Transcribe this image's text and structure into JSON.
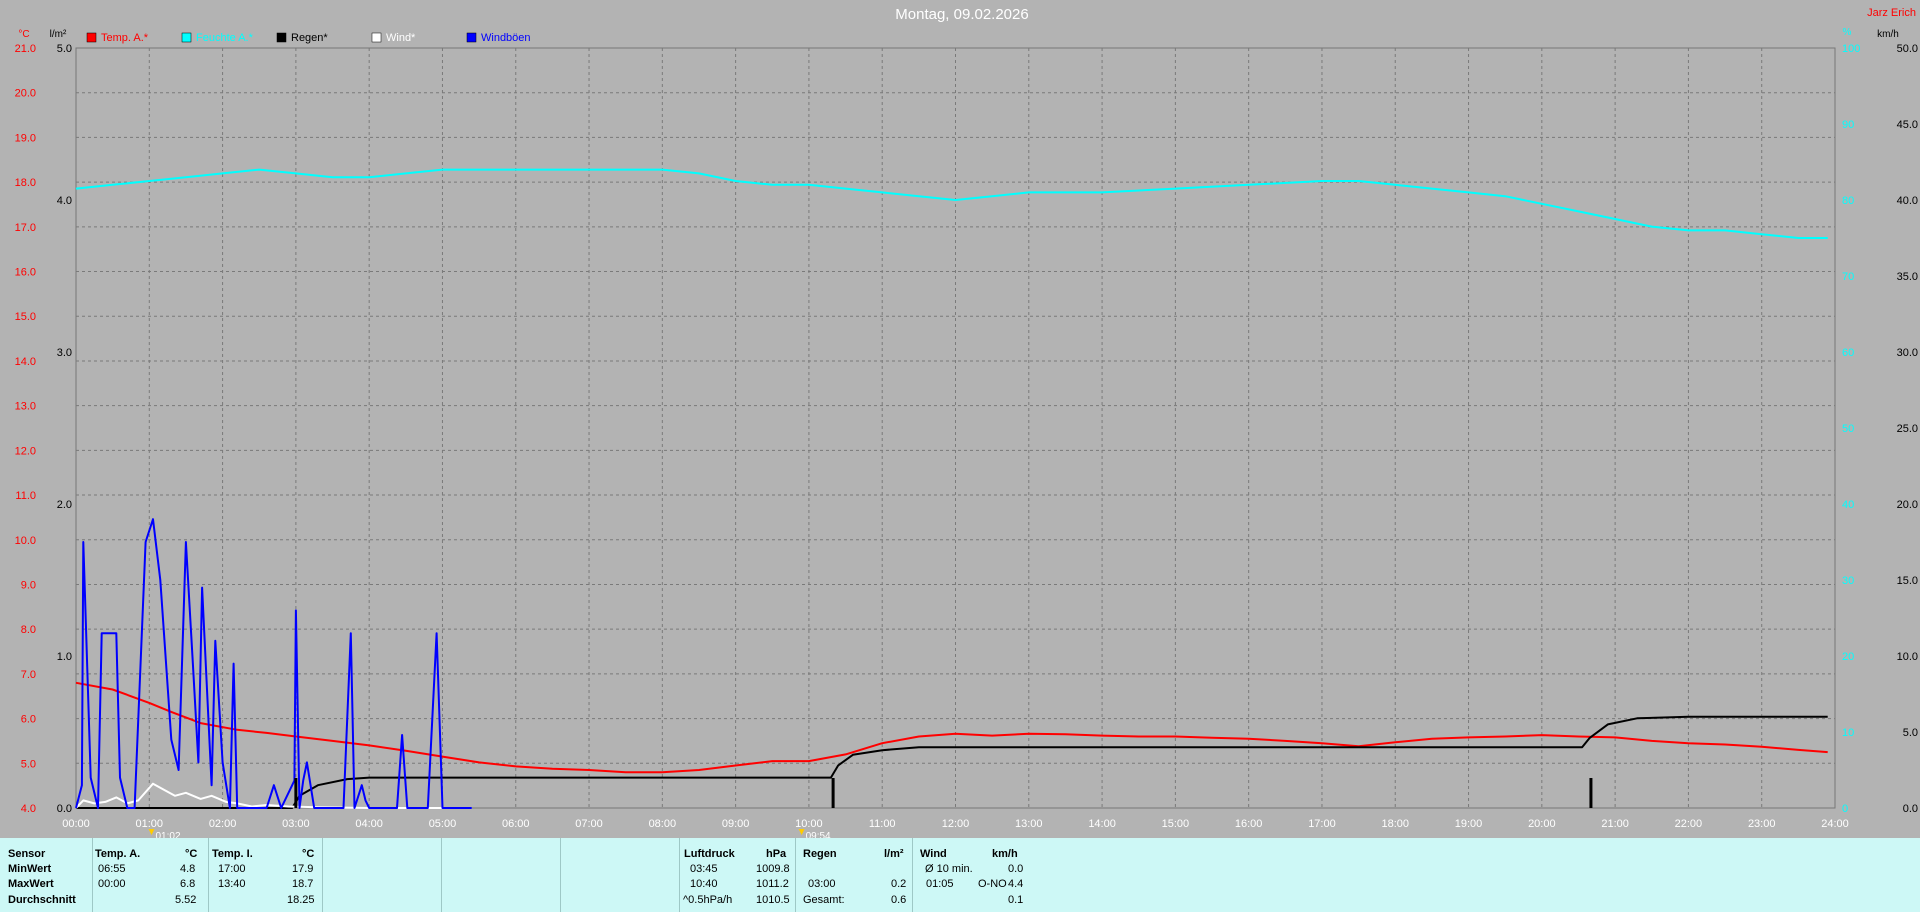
{
  "title": "Montag, 09.02.2026",
  "station": "Jarz Erich",
  "colors": {
    "background": "#b3b3b3",
    "temp": "#ff0000",
    "humidity": "#00ffff",
    "rain": "#000000",
    "wind": "#ffffff",
    "gusts": "#0000ff"
  },
  "axis_units": {
    "left_temp": "°C",
    "left_rain": "l/m²",
    "right_hum": "%",
    "right_wind": "km/h"
  },
  "legend": [
    {
      "key": "temp",
      "label": "Temp. A.*",
      "color": "#ff0000"
    },
    {
      "key": "humidity",
      "label": "Feuchte A.*",
      "color": "#00ffff"
    },
    {
      "key": "rain",
      "label": "Regen*",
      "color": "#000000"
    },
    {
      "key": "wind",
      "label": "Wind*",
      "color": "#ffffff"
    },
    {
      "key": "gusts",
      "label": "Windböen",
      "color": "#0000ff"
    }
  ],
  "markers": [
    {
      "x": 1.03,
      "label": "01:02"
    },
    {
      "x": 9.9,
      "label": "09:54"
    }
  ],
  "chart_data": {
    "type": "line",
    "x_unit": "hour of day",
    "xlim": [
      0,
      24
    ],
    "x_ticks": [
      "00:00",
      "01:00",
      "02:00",
      "03:00",
      "04:00",
      "05:00",
      "06:00",
      "07:00",
      "08:00",
      "09:00",
      "10:00",
      "11:00",
      "12:00",
      "13:00",
      "14:00",
      "15:00",
      "16:00",
      "17:00",
      "18:00",
      "19:00",
      "20:00",
      "21:00",
      "22:00",
      "23:00",
      "24:00"
    ],
    "axes": {
      "temp": {
        "range": [
          4,
          21
        ],
        "ticks": [
          "4.0",
          "5.0",
          "6.0",
          "7.0",
          "8.0",
          "9.0",
          "10.0",
          "11.0",
          "12.0",
          "13.0",
          "14.0",
          "15.0",
          "16.0",
          "17.0",
          "18.0",
          "19.0",
          "20.0",
          "21.0"
        ]
      },
      "rain": {
        "range": [
          0,
          5
        ],
        "ticks": [
          "0.0",
          "1.0",
          "2.0",
          "3.0",
          "4.0",
          "5.0"
        ]
      },
      "humidity": {
        "range": [
          0,
          100
        ],
        "ticks": [
          "0",
          "10",
          "20",
          "30",
          "40",
          "50",
          "60",
          "70",
          "80",
          "90",
          "100"
        ]
      },
      "wind": {
        "range": [
          0,
          50
        ],
        "ticks": [
          "0.0",
          "5.0",
          "10.0",
          "15.0",
          "20.0",
          "25.0",
          "30.0",
          "35.0",
          "40.0",
          "45.0",
          "50.0"
        ]
      }
    },
    "series": [
      {
        "name": "Temp. A.*",
        "axis": "temp",
        "points": [
          [
            0,
            6.8
          ],
          [
            0.5,
            6.65
          ],
          [
            1,
            6.35
          ],
          [
            1.3,
            6.15
          ],
          [
            1.7,
            5.9
          ],
          [
            2.2,
            5.75
          ],
          [
            2.6,
            5.68
          ],
          [
            3,
            5.6
          ],
          [
            3.5,
            5.5
          ],
          [
            4,
            5.4
          ],
          [
            4.5,
            5.28
          ],
          [
            5,
            5.15
          ],
          [
            5.5,
            5.02
          ],
          [
            6,
            4.93
          ],
          [
            6.5,
            4.88
          ],
          [
            7,
            4.85
          ],
          [
            7.5,
            4.8
          ],
          [
            8,
            4.8
          ],
          [
            8.5,
            4.85
          ],
          [
            9,
            4.95
          ],
          [
            9.5,
            5.05
          ],
          [
            10,
            5.05
          ],
          [
            10.5,
            5.2
          ],
          [
            11,
            5.45
          ],
          [
            11.5,
            5.6
          ],
          [
            12,
            5.66
          ],
          [
            12.5,
            5.62
          ],
          [
            13,
            5.66
          ],
          [
            13.5,
            5.65
          ],
          [
            14,
            5.62
          ],
          [
            14.5,
            5.6
          ],
          [
            15,
            5.6
          ],
          [
            15.5,
            5.57
          ],
          [
            16,
            5.55
          ],
          [
            16.5,
            5.5
          ],
          [
            17,
            5.45
          ],
          [
            17.5,
            5.38
          ],
          [
            18,
            5.47
          ],
          [
            18.5,
            5.55
          ],
          [
            19,
            5.58
          ],
          [
            19.5,
            5.6
          ],
          [
            20,
            5.63
          ],
          [
            20.5,
            5.6
          ],
          [
            21,
            5.58
          ],
          [
            21.5,
            5.5
          ],
          [
            22,
            5.45
          ],
          [
            22.5,
            5.42
          ],
          [
            23,
            5.37
          ],
          [
            23.5,
            5.3
          ],
          [
            23.9,
            5.25
          ]
        ]
      },
      {
        "name": "Feuchte A.*",
        "axis": "humidity",
        "points": [
          [
            0,
            81.5
          ],
          [
            0.5,
            82
          ],
          [
            1,
            82.5
          ],
          [
            1.5,
            83
          ],
          [
            2,
            83.5
          ],
          [
            2.5,
            84
          ],
          [
            3,
            83.5
          ],
          [
            3.5,
            83
          ],
          [
            4,
            83
          ],
          [
            4.5,
            83.5
          ],
          [
            5,
            84
          ],
          [
            6,
            84
          ],
          [
            7,
            84
          ],
          [
            8,
            84
          ],
          [
            8.5,
            83.5
          ],
          [
            9,
            82.5
          ],
          [
            9.5,
            82
          ],
          [
            10,
            82
          ],
          [
            10.5,
            81.5
          ],
          [
            11,
            81
          ],
          [
            11.5,
            80.5
          ],
          [
            12,
            80
          ],
          [
            12.5,
            80.5
          ],
          [
            13,
            81
          ],
          [
            14,
            81
          ],
          [
            15,
            81.5
          ],
          [
            16,
            82
          ],
          [
            17,
            82.5
          ],
          [
            17.5,
            82.5
          ],
          [
            18,
            82
          ],
          [
            18.5,
            81.5
          ],
          [
            19,
            81
          ],
          [
            19.5,
            80.5
          ],
          [
            20,
            79.5
          ],
          [
            20.5,
            78.5
          ],
          [
            21,
            77.5
          ],
          [
            21.5,
            76.5
          ],
          [
            22,
            76
          ],
          [
            22.5,
            76
          ],
          [
            23,
            75.5
          ],
          [
            23.5,
            75
          ],
          [
            23.9,
            75
          ]
        ]
      },
      {
        "name": "Regen*",
        "axis": "rain",
        "points": [
          [
            0,
            0
          ],
          [
            2.95,
            0
          ],
          [
            3.05,
            0.08
          ],
          [
            3.3,
            0.15
          ],
          [
            3.7,
            0.19
          ],
          [
            4,
            0.2
          ],
          [
            10.3,
            0.2
          ],
          [
            10.4,
            0.28
          ],
          [
            10.6,
            0.35
          ],
          [
            11,
            0.38
          ],
          [
            11.5,
            0.4
          ],
          [
            20.55,
            0.4
          ],
          [
            20.65,
            0.46
          ],
          [
            20.9,
            0.55
          ],
          [
            21.3,
            0.59
          ],
          [
            22,
            0.6
          ],
          [
            23.9,
            0.6
          ]
        ]
      },
      {
        "name": "Wind*",
        "axis": "wind",
        "points": [
          [
            0,
            0
          ],
          [
            0.1,
            0.5
          ],
          [
            0.25,
            0.3
          ],
          [
            0.4,
            0.4
          ],
          [
            0.55,
            0.7
          ],
          [
            0.7,
            0.3
          ],
          [
            0.85,
            0.5
          ],
          [
            1.05,
            1.6
          ],
          [
            1.2,
            1.2
          ],
          [
            1.35,
            0.8
          ],
          [
            1.5,
            1.0
          ],
          [
            1.7,
            0.6
          ],
          [
            1.85,
            0.8
          ],
          [
            2.05,
            0.4
          ],
          [
            2.2,
            0.3
          ],
          [
            2.4,
            0.1
          ],
          [
            2.6,
            0.2
          ],
          [
            2.9,
            0.1
          ],
          [
            3.3,
            0.05
          ],
          [
            4,
            0
          ],
          [
            5.4,
            0
          ]
        ]
      },
      {
        "name": "Windböen",
        "axis": "gusts",
        "points": [
          [
            0,
            0
          ],
          [
            0.08,
            1.5
          ],
          [
            0.1,
            17.5
          ],
          [
            0.2,
            2
          ],
          [
            0.3,
            0
          ],
          [
            0.35,
            11.5
          ],
          [
            0.55,
            11.5
          ],
          [
            0.6,
            2
          ],
          [
            0.7,
            0
          ],
          [
            0.8,
            0
          ],
          [
            0.95,
            17.5
          ],
          [
            1.05,
            19
          ],
          [
            1.15,
            15
          ],
          [
            1.3,
            4.5
          ],
          [
            1.4,
            2.5
          ],
          [
            1.5,
            17.5
          ],
          [
            1.6,
            9
          ],
          [
            1.67,
            3
          ],
          [
            1.72,
            14.5
          ],
          [
            1.85,
            1.5
          ],
          [
            1.9,
            11
          ],
          [
            2.0,
            3
          ],
          [
            2.1,
            0
          ],
          [
            2.15,
            9.5
          ],
          [
            2.2,
            0
          ],
          [
            2.6,
            0
          ],
          [
            2.7,
            1.5
          ],
          [
            2.8,
            0
          ],
          [
            2.98,
            1.8
          ],
          [
            3.0,
            13
          ],
          [
            3.05,
            0
          ],
          [
            3.1,
            1.8
          ],
          [
            3.15,
            3.0
          ],
          [
            3.25,
            0
          ],
          [
            3.65,
            0
          ],
          [
            3.75,
            11.5
          ],
          [
            3.8,
            0
          ],
          [
            3.9,
            1.5
          ],
          [
            3.95,
            0.5
          ],
          [
            4.0,
            0
          ],
          [
            4.38,
            0
          ],
          [
            4.45,
            4.8
          ],
          [
            4.52,
            0
          ],
          [
            4.8,
            0
          ],
          [
            4.92,
            11.5
          ],
          [
            5.0,
            0
          ],
          [
            5.4,
            0
          ]
        ]
      }
    ]
  },
  "stats": {
    "headers": {
      "sensor": "Sensor",
      "temp_a": "Temp. A.",
      "temp_a_unit": "°C",
      "temp_i": "Temp. I.",
      "temp_i_unit": "°C",
      "pressure": "Luftdruck",
      "pressure_unit": "hPa",
      "rain": "Regen",
      "rain_unit": "l/m²",
      "wind": "Wind",
      "wind_unit": "km/h"
    },
    "row_labels": {
      "min": "MinWert",
      "max": "MaxWert",
      "avg": "Durchschnitt"
    },
    "temp_a": {
      "min_time": "06:55",
      "min": "4.8",
      "max_time": "00:00",
      "max": "6.8",
      "avg": "5.52"
    },
    "temp_i": {
      "min_time": "17:00",
      "min": "17.9",
      "max_time": "13:40",
      "max": "18.7",
      "avg": "18.25"
    },
    "pressure": {
      "min_time": "03:45",
      "min": "1009.8",
      "max_time": "10:40",
      "max": "1011.2",
      "trend_label": "^0.5hPa/h",
      "avg": "1010.5"
    },
    "rain": {
      "max_time": "03:00",
      "max": "0.2",
      "total_label": "Gesamt:",
      "total": "0.6"
    },
    "wind": {
      "avg_label": "Ø 10 min.",
      "avg": "0.0",
      "max_time": "01:05",
      "max_dir": "O-NO",
      "max": "4.4",
      "day_avg": "0.1"
    }
  }
}
